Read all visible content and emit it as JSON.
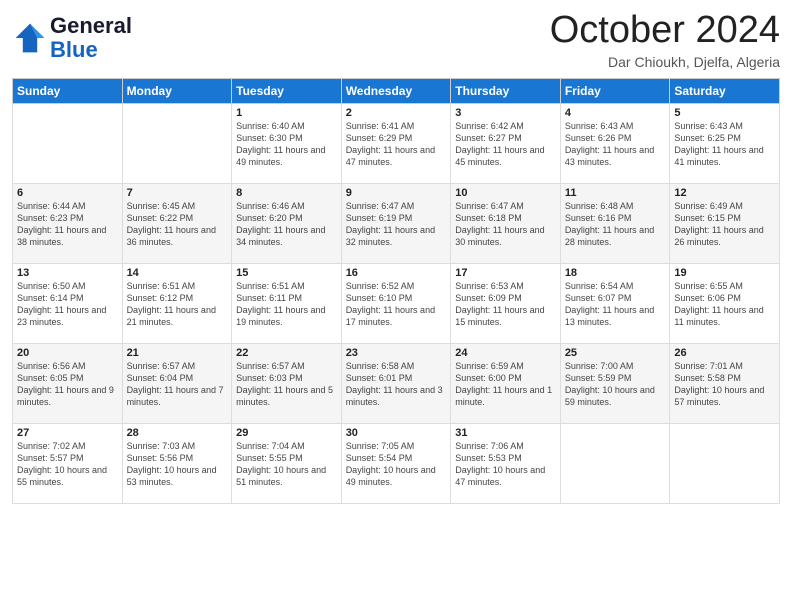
{
  "header": {
    "logo_line1": "General",
    "logo_line2": "Blue",
    "month_title": "October 2024",
    "location": "Dar Chioukh, Djelfa, Algeria"
  },
  "days_of_week": [
    "Sunday",
    "Monday",
    "Tuesday",
    "Wednesday",
    "Thursday",
    "Friday",
    "Saturday"
  ],
  "weeks": [
    [
      {
        "day": "",
        "content": ""
      },
      {
        "day": "",
        "content": ""
      },
      {
        "day": "1",
        "content": "Sunrise: 6:40 AM\nSunset: 6:30 PM\nDaylight: 11 hours and 49 minutes."
      },
      {
        "day": "2",
        "content": "Sunrise: 6:41 AM\nSunset: 6:29 PM\nDaylight: 11 hours and 47 minutes."
      },
      {
        "day": "3",
        "content": "Sunrise: 6:42 AM\nSunset: 6:27 PM\nDaylight: 11 hours and 45 minutes."
      },
      {
        "day": "4",
        "content": "Sunrise: 6:43 AM\nSunset: 6:26 PM\nDaylight: 11 hours and 43 minutes."
      },
      {
        "day": "5",
        "content": "Sunrise: 6:43 AM\nSunset: 6:25 PM\nDaylight: 11 hours and 41 minutes."
      }
    ],
    [
      {
        "day": "6",
        "content": "Sunrise: 6:44 AM\nSunset: 6:23 PM\nDaylight: 11 hours and 38 minutes."
      },
      {
        "day": "7",
        "content": "Sunrise: 6:45 AM\nSunset: 6:22 PM\nDaylight: 11 hours and 36 minutes."
      },
      {
        "day": "8",
        "content": "Sunrise: 6:46 AM\nSunset: 6:20 PM\nDaylight: 11 hours and 34 minutes."
      },
      {
        "day": "9",
        "content": "Sunrise: 6:47 AM\nSunset: 6:19 PM\nDaylight: 11 hours and 32 minutes."
      },
      {
        "day": "10",
        "content": "Sunrise: 6:47 AM\nSunset: 6:18 PM\nDaylight: 11 hours and 30 minutes."
      },
      {
        "day": "11",
        "content": "Sunrise: 6:48 AM\nSunset: 6:16 PM\nDaylight: 11 hours and 28 minutes."
      },
      {
        "day": "12",
        "content": "Sunrise: 6:49 AM\nSunset: 6:15 PM\nDaylight: 11 hours and 26 minutes."
      }
    ],
    [
      {
        "day": "13",
        "content": "Sunrise: 6:50 AM\nSunset: 6:14 PM\nDaylight: 11 hours and 23 minutes."
      },
      {
        "day": "14",
        "content": "Sunrise: 6:51 AM\nSunset: 6:12 PM\nDaylight: 11 hours and 21 minutes."
      },
      {
        "day": "15",
        "content": "Sunrise: 6:51 AM\nSunset: 6:11 PM\nDaylight: 11 hours and 19 minutes."
      },
      {
        "day": "16",
        "content": "Sunrise: 6:52 AM\nSunset: 6:10 PM\nDaylight: 11 hours and 17 minutes."
      },
      {
        "day": "17",
        "content": "Sunrise: 6:53 AM\nSunset: 6:09 PM\nDaylight: 11 hours and 15 minutes."
      },
      {
        "day": "18",
        "content": "Sunrise: 6:54 AM\nSunset: 6:07 PM\nDaylight: 11 hours and 13 minutes."
      },
      {
        "day": "19",
        "content": "Sunrise: 6:55 AM\nSunset: 6:06 PM\nDaylight: 11 hours and 11 minutes."
      }
    ],
    [
      {
        "day": "20",
        "content": "Sunrise: 6:56 AM\nSunset: 6:05 PM\nDaylight: 11 hours and 9 minutes."
      },
      {
        "day": "21",
        "content": "Sunrise: 6:57 AM\nSunset: 6:04 PM\nDaylight: 11 hours and 7 minutes."
      },
      {
        "day": "22",
        "content": "Sunrise: 6:57 AM\nSunset: 6:03 PM\nDaylight: 11 hours and 5 minutes."
      },
      {
        "day": "23",
        "content": "Sunrise: 6:58 AM\nSunset: 6:01 PM\nDaylight: 11 hours and 3 minutes."
      },
      {
        "day": "24",
        "content": "Sunrise: 6:59 AM\nSunset: 6:00 PM\nDaylight: 11 hours and 1 minute."
      },
      {
        "day": "25",
        "content": "Sunrise: 7:00 AM\nSunset: 5:59 PM\nDaylight: 10 hours and 59 minutes."
      },
      {
        "day": "26",
        "content": "Sunrise: 7:01 AM\nSunset: 5:58 PM\nDaylight: 10 hours and 57 minutes."
      }
    ],
    [
      {
        "day": "27",
        "content": "Sunrise: 7:02 AM\nSunset: 5:57 PM\nDaylight: 10 hours and 55 minutes."
      },
      {
        "day": "28",
        "content": "Sunrise: 7:03 AM\nSunset: 5:56 PM\nDaylight: 10 hours and 53 minutes."
      },
      {
        "day": "29",
        "content": "Sunrise: 7:04 AM\nSunset: 5:55 PM\nDaylight: 10 hours and 51 minutes."
      },
      {
        "day": "30",
        "content": "Sunrise: 7:05 AM\nSunset: 5:54 PM\nDaylight: 10 hours and 49 minutes."
      },
      {
        "day": "31",
        "content": "Sunrise: 7:06 AM\nSunset: 5:53 PM\nDaylight: 10 hours and 47 minutes."
      },
      {
        "day": "",
        "content": ""
      },
      {
        "day": "",
        "content": ""
      }
    ]
  ]
}
